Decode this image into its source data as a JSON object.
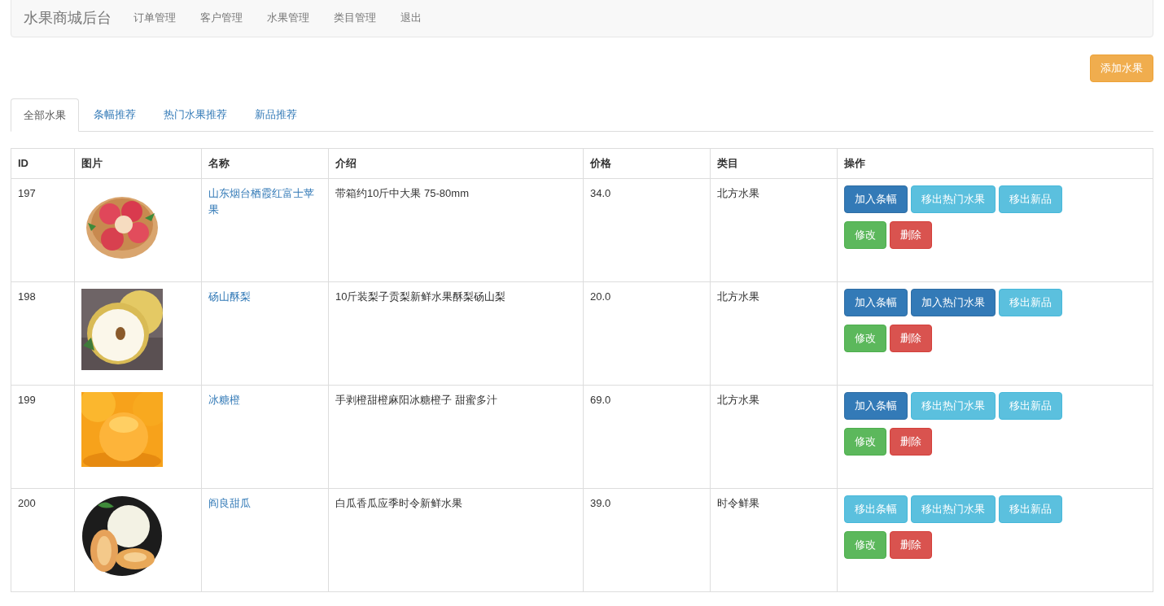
{
  "navbar": {
    "brand": "水果商城后台",
    "links": [
      "订单管理",
      "客户管理",
      "水果管理",
      "类目管理",
      "退出"
    ]
  },
  "add_button": "添加水果",
  "tabs": [
    {
      "label": "全部水果",
      "selected": true
    },
    {
      "label": "条幅推荐",
      "selected": false
    },
    {
      "label": "热门水果推荐",
      "selected": false
    },
    {
      "label": "新品推荐",
      "selected": false
    }
  ],
  "table": {
    "columns": [
      "ID",
      "图片",
      "名称",
      "介绍",
      "价格",
      "类目",
      "操作"
    ],
    "rows": [
      {
        "id": "197",
        "name": "山东烟台栖霞红富士苹果",
        "intro": "带箱约10斤中大果 75-80mm",
        "price": "34.0",
        "category": "北方水果",
        "buttons": [
          {
            "label": "加入条幅",
            "kind": "add"
          },
          {
            "label": "移出热门水果",
            "kind": "remove"
          },
          {
            "label": "移出新品",
            "kind": "remove"
          },
          {
            "label": "修改",
            "kind": "edit"
          },
          {
            "label": "删除",
            "kind": "delete"
          }
        ]
      },
      {
        "id": "198",
        "name": "砀山酥梨",
        "intro": "10斤装梨子贡梨新鲜水果酥梨砀山梨",
        "price": "20.0",
        "category": "北方水果",
        "buttons": [
          {
            "label": "加入条幅",
            "kind": "add"
          },
          {
            "label": "加入热门水果",
            "kind": "add"
          },
          {
            "label": "移出新品",
            "kind": "remove"
          },
          {
            "label": "修改",
            "kind": "edit"
          },
          {
            "label": "删除",
            "kind": "delete"
          }
        ]
      },
      {
        "id": "199",
        "name": "冰糖橙",
        "intro": "手剥橙甜橙麻阳冰糖橙子 甜蜜多汁",
        "price": "69.0",
        "category": "北方水果",
        "buttons": [
          {
            "label": "加入条幅",
            "kind": "add"
          },
          {
            "label": "移出热门水果",
            "kind": "remove"
          },
          {
            "label": "移出新品",
            "kind": "remove"
          },
          {
            "label": "修改",
            "kind": "edit"
          },
          {
            "label": "删除",
            "kind": "delete"
          }
        ]
      },
      {
        "id": "200",
        "name": "阎良甜瓜",
        "intro": "白瓜香瓜应季时令新鲜水果",
        "price": "39.0",
        "category": "时令鲜果",
        "buttons": [
          {
            "label": "移出条幅",
            "kind": "remove"
          },
          {
            "label": "移出热门水果",
            "kind": "remove"
          },
          {
            "label": "移出新品",
            "kind": "remove"
          },
          {
            "label": "修改",
            "kind": "edit"
          },
          {
            "label": "删除",
            "kind": "delete"
          }
        ]
      }
    ]
  }
}
